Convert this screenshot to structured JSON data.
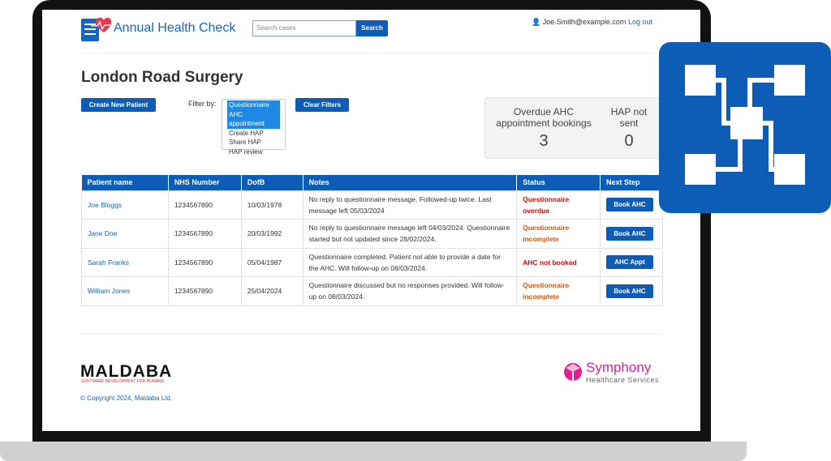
{
  "app": {
    "title": "Annual Health Check"
  },
  "search": {
    "placeholder": "Search cases",
    "button": "Search"
  },
  "user": {
    "email": "Joe.Smith@example.com",
    "logout": "Log out"
  },
  "page": {
    "title": "London Road Surgery"
  },
  "toolbar": {
    "create": "Create New Patient",
    "filter_label": "Filter by:",
    "clear": "Clear Filters"
  },
  "filter_options": [
    {
      "label": "Questionnaire",
      "selected": true
    },
    {
      "label": "AHC appointment",
      "selected": true
    },
    {
      "label": "Create HAP",
      "selected": false
    },
    {
      "label": "Share HAP",
      "selected": false
    },
    {
      "label": "HAP review",
      "selected": false
    }
  ],
  "stats": [
    {
      "label": "Overdue AHC appointment bookings",
      "value": "3"
    },
    {
      "label": "HAP not sent",
      "value": "0"
    }
  ],
  "table": {
    "headers": [
      "Patient name",
      "NHS Number",
      "DofB",
      "Notes",
      "Status",
      "Next Step"
    ],
    "rows": [
      {
        "name": "Joe Bloggs",
        "nhs": "1234567890",
        "dob": "10/03/1978",
        "notes": "No reply to questionnaire message. Followed-up twice. Last message left 05/03/2024",
        "status": "Questionnaire overdue",
        "status_color": "#e00000",
        "action": "Book AHC"
      },
      {
        "name": "Jane Doe",
        "nhs": "1234567890",
        "dob": "20/03/1992",
        "notes": "No reply to questionnaire message left 04/03/2024. Questionnaire started but not updated since 28/02/2024.",
        "status": "Questionnaire incomplete",
        "status_color": "#e65100",
        "action": "Book AHC"
      },
      {
        "name": "Sarah Franks",
        "nhs": "1234567890",
        "dob": "05/04/1987",
        "notes": "Questionnaire completed. Patient not able to provide a date for the AHC. Will follow-up on 08/03/2024.",
        "status": "AHC not booked",
        "status_color": "#e00000",
        "action": "AHC Appt"
      },
      {
        "name": "William Jones",
        "nhs": "1234567890",
        "dob": "25/04/2024",
        "notes": "Questionnaire discussed but no responses provided. Will follow-up on 08/03/2024.",
        "status": "Questionnaire incomplete",
        "status_color": "#e65100",
        "action": "Book AHC"
      }
    ]
  },
  "footer": {
    "maldaba": "MALDABA",
    "maldaba_tagline": "SOFTWARE DEVELOPMENT FOR HUMANS",
    "copyright": "© Copyright 2024, Maldaba Ltd.",
    "symphony": "Symphony",
    "symphony_sub": "Healthcare Services"
  },
  "colors": {
    "primary": "#0d5cb6",
    "overdue": "#e00000",
    "incomplete": "#e65100",
    "symphony": "#e91e8c"
  }
}
